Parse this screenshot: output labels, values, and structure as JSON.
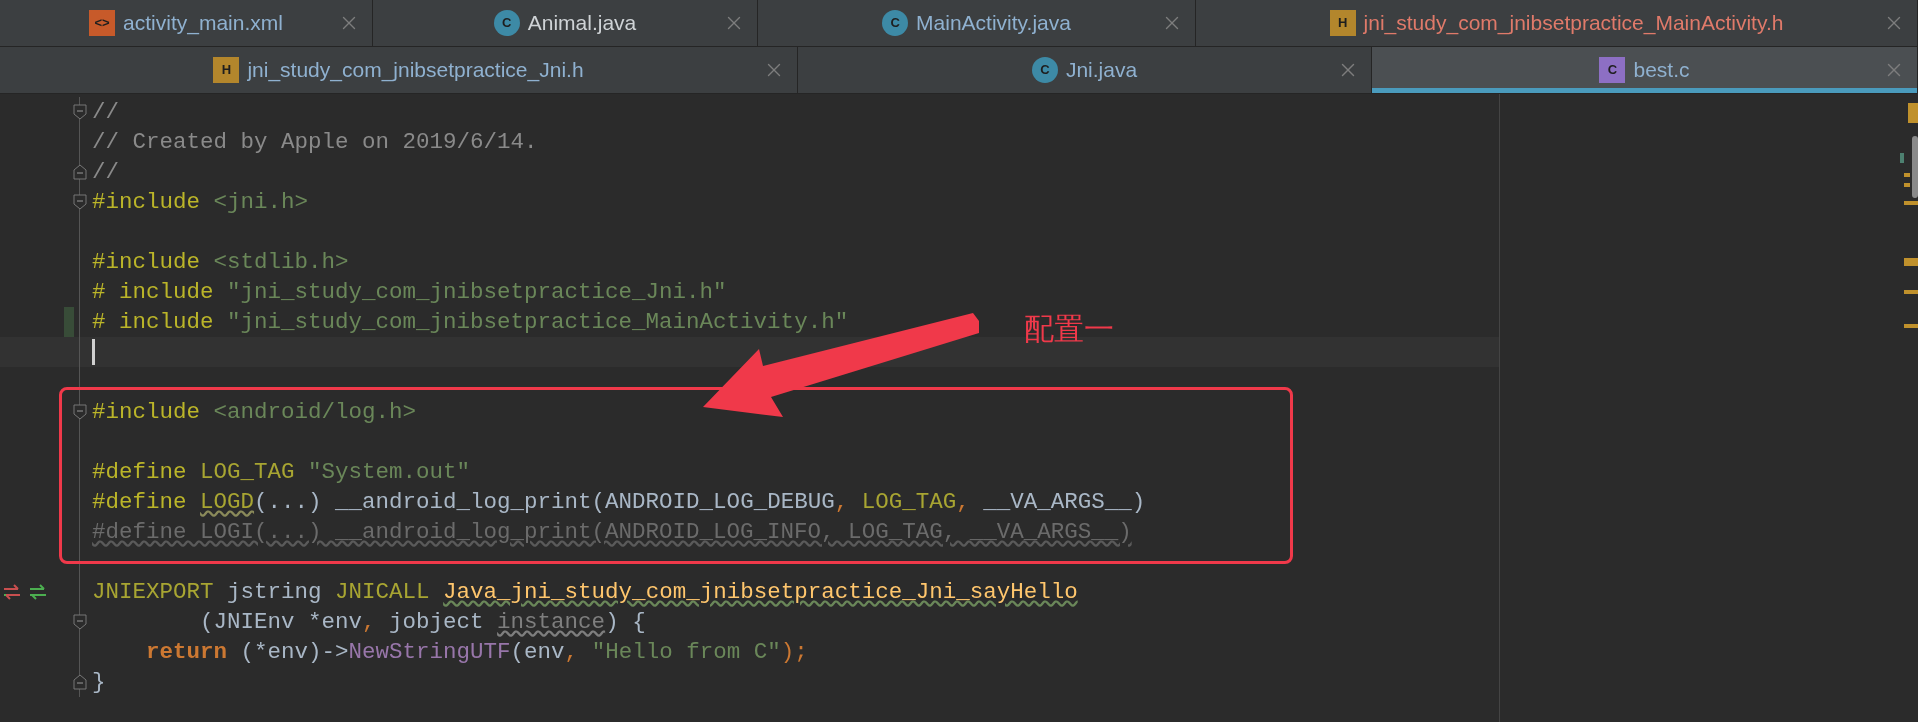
{
  "tab_rows": [
    {
      "tabs": [
        {
          "icon": {
            "kind": "xml",
            "text": "<>"
          },
          "label": "activity_main.xml",
          "status": {
            "kind": "modified"
          },
          "selected": false
        },
        {
          "icon": {
            "kind": "class",
            "text": "C"
          },
          "label": "Animal.java",
          "status": {
            "kind": "unchanged"
          },
          "selected": false
        },
        {
          "icon": {
            "kind": "class",
            "text": "C"
          },
          "label": "MainActivity.java",
          "status": {
            "kind": "modified"
          },
          "selected": false
        },
        {
          "icon": {
            "kind": "header",
            "text": "H"
          },
          "label": "jni_study_com_jnibsetpractice_MainActivity.h",
          "status": {
            "kind": "error"
          },
          "selected": false
        }
      ]
    },
    {
      "tabs": [
        {
          "icon": {
            "kind": "header",
            "text": "H"
          },
          "label": "jni_study_com_jnibsetpractice_Jni.h",
          "status": {
            "kind": "modified"
          },
          "selected": false
        },
        {
          "icon": {
            "kind": "class",
            "text": "C"
          },
          "label": "Jni.java",
          "status": {
            "kind": "modified"
          },
          "selected": false
        },
        {
          "icon": {
            "kind": "c",
            "text": "C"
          },
          "label": "best.c",
          "status": {
            "kind": "modified"
          },
          "selected": true
        }
      ]
    }
  ],
  "code_lines": [
    {
      "kind": "code",
      "fold": {
        "kind": "start"
      },
      "segments": [
        {
          "text": "//",
          "kind": "comment"
        }
      ]
    },
    {
      "kind": "code",
      "segments": [
        {
          "text": "// Created by Apple on 2019/6/14.",
          "kind": "comment"
        }
      ]
    },
    {
      "kind": "code",
      "fold": {
        "kind": "end"
      },
      "segments": [
        {
          "text": "//",
          "kind": "comment"
        }
      ]
    },
    {
      "kind": "code",
      "fold": {
        "kind": "start"
      },
      "segments": [
        {
          "text": "#include",
          "kind": "directive"
        },
        {
          "text": " <jni.h>",
          "kind": "header"
        }
      ]
    },
    {
      "kind": "blank"
    },
    {
      "kind": "code",
      "segments": [
        {
          "text": "#include",
          "kind": "directive"
        },
        {
          "text": " <stdlib.h>",
          "kind": "header"
        }
      ]
    },
    {
      "kind": "code",
      "segments": [
        {
          "text": "# include",
          "kind": "directive"
        },
        {
          "text": " \"jni_study_com_jnibsetpractice_Jni.h\"",
          "kind": "header"
        }
      ]
    },
    {
      "kind": "code",
      "changed": true,
      "segments": [
        {
          "text": "# include",
          "kind": "directive"
        },
        {
          "text": " \"jni_study_com_jnibsetpractice_MainActivity.h\"",
          "kind": "header"
        }
      ]
    },
    {
      "kind": "caret"
    },
    {
      "kind": "blank"
    },
    {
      "kind": "code",
      "fold": {
        "kind": "start"
      },
      "segments": [
        {
          "text": "#include",
          "kind": "directive"
        },
        {
          "text": " <android/log.h>",
          "kind": "header"
        }
      ]
    },
    {
      "kind": "blank"
    },
    {
      "kind": "code",
      "segments": [
        {
          "text": "#define",
          "kind": "directive"
        },
        {
          "text": " LOG_TAG",
          "kind": "macro"
        },
        {
          "text": " \"System.out\"",
          "kind": "string"
        }
      ]
    },
    {
      "kind": "code",
      "segments": [
        {
          "text": "#define ",
          "kind": "directive"
        },
        {
          "text": "LOGD",
          "kind": "macro-warned"
        },
        {
          "text": "(...) __android_log_print(ANDROID_LOG_DEBUG",
          "kind": "plain"
        },
        {
          "text": ",",
          "kind": "punct"
        },
        {
          "text": " LOG_TAG",
          "kind": "macro"
        },
        {
          "text": ",",
          "kind": "punct"
        },
        {
          "text": " __VA_ARGS__)",
          "kind": "plain"
        }
      ]
    },
    {
      "kind": "code",
      "segments": [
        {
          "text": "#define LOGI(...) __android_log_print(ANDROID_LOG_INFO, LOG_TAG, __VA_ARGS__)",
          "kind": "disabled"
        }
      ]
    },
    {
      "kind": "blank"
    },
    {
      "kind": "code",
      "gutter_icon": {
        "kind": "arrows"
      },
      "segments": [
        {
          "text": "JNIEXPORT",
          "kind": "macro"
        },
        {
          "text": " jstring ",
          "kind": "plain"
        },
        {
          "text": "JNICALL ",
          "kind": "macro"
        },
        {
          "text": "Java_jni_study_com_jnibsetpractice_Jni_sayHello",
          "kind": "function-warned"
        }
      ]
    },
    {
      "kind": "code",
      "fold": {
        "kind": "start"
      },
      "segments": [
        {
          "text": "        (JNIEnv *env",
          "kind": "plain"
        },
        {
          "text": ",",
          "kind": "punct"
        },
        {
          "text": " jobject ",
          "kind": "plain"
        },
        {
          "text": "instance",
          "kind": "unused"
        },
        {
          "text": ") {",
          "kind": "plain"
        }
      ]
    },
    {
      "kind": "code",
      "segments": [
        {
          "text": "    return",
          "kind": "keyword"
        },
        {
          "text": " (*env)->",
          "kind": "plain"
        },
        {
          "text": "NewStringUTF",
          "kind": "call"
        },
        {
          "text": "(env",
          "kind": "plain"
        },
        {
          "text": ",",
          "kind": "punct"
        },
        {
          "text": " \"Hello from C\"",
          "kind": "string"
        },
        {
          "text": ");",
          "kind": "punct"
        }
      ]
    },
    {
      "kind": "code",
      "fold": {
        "kind": "end"
      },
      "segments": [
        {
          "text": "}",
          "kind": "plain"
        }
      ]
    }
  ],
  "annotation": {
    "label": "配置一"
  }
}
